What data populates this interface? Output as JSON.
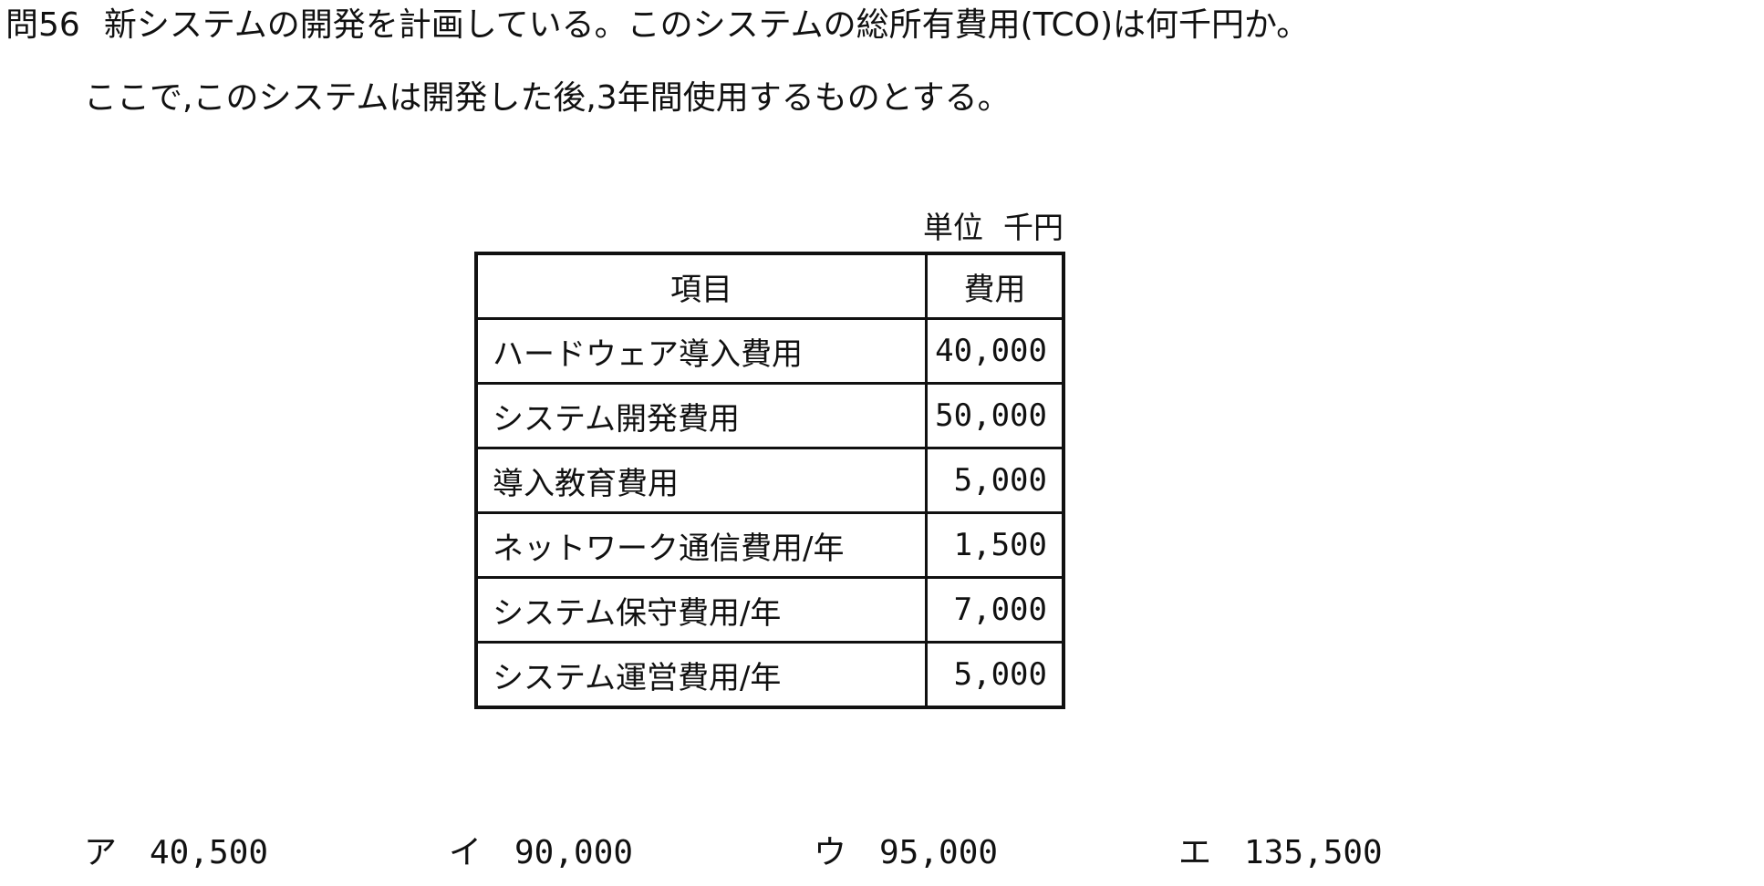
{
  "question": {
    "number": "問56",
    "line1": "新システムの開発を計画している。このシステムの総所有費用(TCO)は何千円か。",
    "line2": "ここで,このシステムは開発した後,3年間使用するものとする。"
  },
  "table": {
    "unit_label": "単位",
    "unit_value": "千円",
    "headers": [
      "項目",
      "費用"
    ],
    "rows": [
      {
        "item": "ハードウェア導入費用",
        "cost": "40,000"
      },
      {
        "item": "システム開発費用",
        "cost": "50,000"
      },
      {
        "item": "導入教育費用",
        "cost": "5,000"
      },
      {
        "item": "ネットワーク通信費用/年",
        "cost": "1,500"
      },
      {
        "item": "システム保守費用/年",
        "cost": "7,000"
      },
      {
        "item": "システム運営費用/年",
        "cost": "5,000"
      }
    ]
  },
  "choices": [
    {
      "label": "ア",
      "value": "40,500"
    },
    {
      "label": "イ",
      "value": "90,000"
    },
    {
      "label": "ウ",
      "value": "95,000"
    },
    {
      "label": "エ",
      "value": "135,500"
    }
  ]
}
